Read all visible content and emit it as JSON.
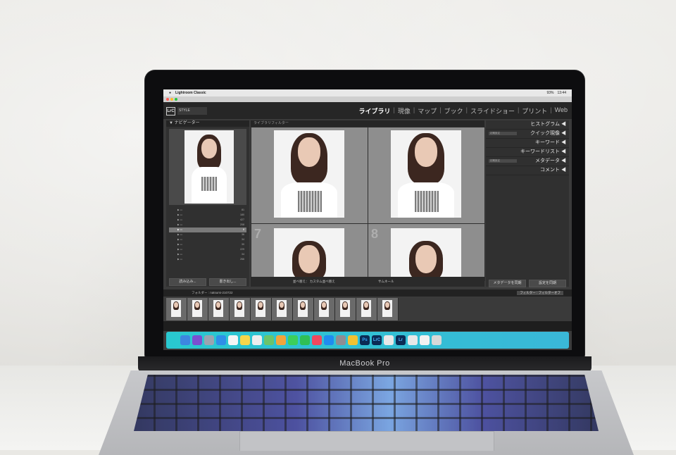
{
  "menubar": {
    "app_name": "Lightroom Classic",
    "battery": "93%",
    "time": "13:44"
  },
  "lr_header": {
    "logo": "LrC",
    "identity_plate": "STYLE",
    "modules": [
      "ライブラリ",
      "現像",
      "マップ",
      "ブック",
      "スライドショー",
      "プリント",
      "Web"
    ],
    "active_module": "ライブラリ"
  },
  "left_panel": {
    "navigator_label": "ナビゲーター",
    "import_button": "読み込み...",
    "export_button": "書き出し..."
  },
  "grid": {
    "toolbar_label": "ライブラリフィルター",
    "row2_left_number": "7",
    "row2_right_number": "8"
  },
  "bottom_toolbar": {
    "sort_label": "並べ替え： カスタム並べ替え",
    "thumbnail_label": "サムネール"
  },
  "right_panel": {
    "rows": [
      {
        "label": "ヒストグラム"
      },
      {
        "label": "クイック現像",
        "preset": "初期設定"
      },
      {
        "label": "キーワード"
      },
      {
        "label": "キーワードリスト"
      },
      {
        "label": "メタデータ",
        "preset": "初期設定"
      },
      {
        "label": "コメント"
      }
    ],
    "sync_metadata_button": "メタデータを同期",
    "sync_settings_button": "設定を同期"
  },
  "filmstrip": {
    "path_label": "フォルダー : natsumi-210722",
    "filter_label": "フィルター :",
    "filter_value": "フィルターオフ",
    "thumb_count": 11
  },
  "dock": {
    "ps_label": "Ps",
    "lrc_label": "LrC",
    "lr_label": "Lr"
  },
  "device": {
    "model": "MacBook Pro"
  }
}
